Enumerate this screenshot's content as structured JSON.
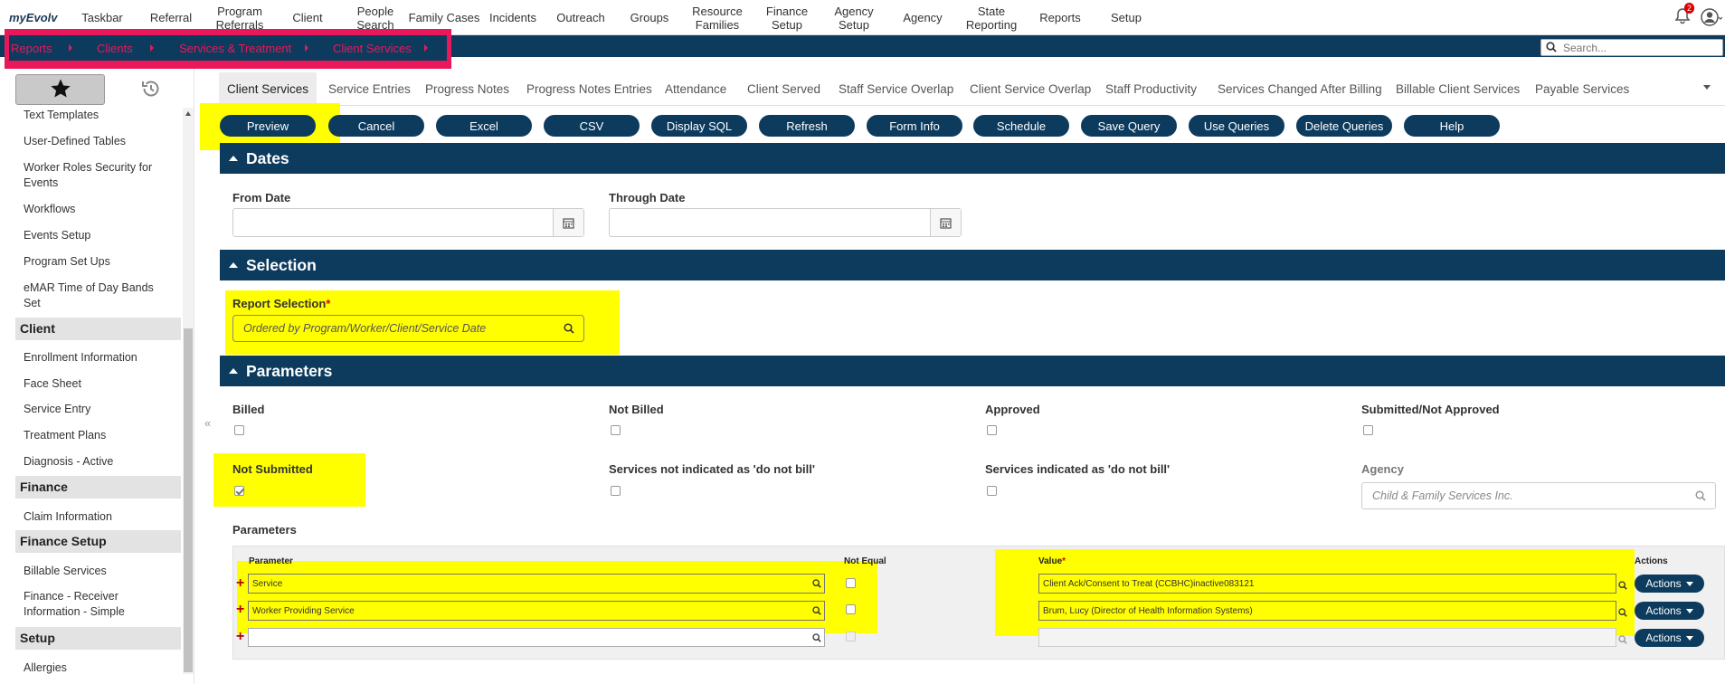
{
  "brand": "myEvolv",
  "topnav": [
    {
      "label": "Taskbar"
    },
    {
      "label": "Referral"
    },
    {
      "label": "Program\nReferrals"
    },
    {
      "label": "Client"
    },
    {
      "label": "People\nSearch"
    },
    {
      "label": "Family Cases"
    },
    {
      "label": "Incidents"
    },
    {
      "label": "Outreach"
    },
    {
      "label": "Groups"
    },
    {
      "label": "Resource\nFamilies"
    },
    {
      "label": "Finance\nSetup"
    },
    {
      "label": "Agency\nSetup"
    },
    {
      "label": "Agency"
    },
    {
      "label": "State\nReporting"
    },
    {
      "label": "Reports"
    },
    {
      "label": "Setup"
    }
  ],
  "notification_count": "2",
  "breadcrumb": [
    "Reports",
    "Clients",
    "Services & Treatment",
    "Client Services"
  ],
  "search": {
    "placeholder": "Search..."
  },
  "sidebar": {
    "items": [
      {
        "type": "item",
        "label": "Text Templates"
      },
      {
        "type": "item",
        "label": "User-Defined Tables"
      },
      {
        "type": "item",
        "label": "Worker Roles Security for Events"
      },
      {
        "type": "item",
        "label": "Workflows"
      },
      {
        "type": "item",
        "label": "Events Setup"
      },
      {
        "type": "item",
        "label": "Program Set Ups"
      },
      {
        "type": "item",
        "label": "eMAR Time of Day Bands Set"
      },
      {
        "type": "head",
        "label": "Client"
      },
      {
        "type": "item",
        "label": "Enrollment Information"
      },
      {
        "type": "item",
        "label": "Face Sheet"
      },
      {
        "type": "item",
        "label": "Service Entry"
      },
      {
        "type": "item",
        "label": "Treatment Plans"
      },
      {
        "type": "item",
        "label": "Diagnosis - Active"
      },
      {
        "type": "head",
        "label": "Finance"
      },
      {
        "type": "item",
        "label": "Claim Information"
      },
      {
        "type": "head",
        "label": "Finance Setup"
      },
      {
        "type": "item",
        "label": "Billable Services"
      },
      {
        "type": "item",
        "label": "Finance - Receiver Information - Simple"
      },
      {
        "type": "head",
        "label": "Setup"
      },
      {
        "type": "item",
        "label": "Allergies"
      }
    ]
  },
  "tabs": [
    {
      "label": "Client Services",
      "active": true
    },
    {
      "label": "Service Entries"
    },
    {
      "label": "Progress Notes"
    },
    {
      "label": "Progress Notes Entries"
    },
    {
      "label": "Attendance"
    },
    {
      "label": "Client Served"
    },
    {
      "label": "Staff Service Overlap"
    },
    {
      "label": "Client Service Overlap"
    },
    {
      "label": "Staff Productivity"
    },
    {
      "label": "Services Changed After Billing"
    },
    {
      "label": "Billable Client Services"
    },
    {
      "label": "Payable Services"
    }
  ],
  "buttons": [
    "Preview",
    "Cancel",
    "Excel",
    "CSV",
    "Display SQL",
    "Refresh",
    "Form Info",
    "Schedule",
    "Save Query",
    "Use Queries",
    "Delete Queries",
    "Help"
  ],
  "sections": {
    "dates": "Dates",
    "selection": "Selection",
    "parameters": "Parameters"
  },
  "dates": {
    "from_label": "From Date",
    "from_value": "",
    "through_label": "Through Date",
    "through_value": ""
  },
  "selection": {
    "label": "Report Selection",
    "required": "*",
    "value": "Ordered by Program/Worker/Client/Service Date"
  },
  "flags": {
    "billed": {
      "label": "Billed",
      "checked": false
    },
    "not_billed": {
      "label": "Not Billed",
      "checked": false
    },
    "approved": {
      "label": "Approved",
      "checked": false
    },
    "submitted_not_approved": {
      "label": "Submitted/Not Approved",
      "checked": false
    },
    "not_submitted": {
      "label": "Not Submitted",
      "checked": true
    },
    "not_do_not_bill": {
      "label": "Services not indicated as 'do not bill'",
      "checked": false
    },
    "do_not_bill": {
      "label": "Services indicated as 'do not bill'",
      "checked": false
    }
  },
  "agency": {
    "label": "Agency",
    "placeholder": "Child & Family Services Inc."
  },
  "params_table": {
    "title": "Parameters",
    "headers": {
      "parameter": "Parameter",
      "not_equal": "Not Equal",
      "value": "Value",
      "value_req": "*",
      "actions": "Actions"
    },
    "rows": [
      {
        "parameter": "Service",
        "value": "Client Ack/Consent to Treat (CCBHC)inactive083121",
        "action": "Actions"
      },
      {
        "parameter": "Worker Providing Service",
        "value": "Brum, Lucy (Director of Health Information Systems)",
        "action": "Actions"
      },
      {
        "parameter": "",
        "value": "",
        "action": "Actions"
      }
    ]
  },
  "colors": {
    "navy": "#0d3b5e",
    "highlight": "#ffff00",
    "breadcrumb_pink": "#e8185a"
  }
}
